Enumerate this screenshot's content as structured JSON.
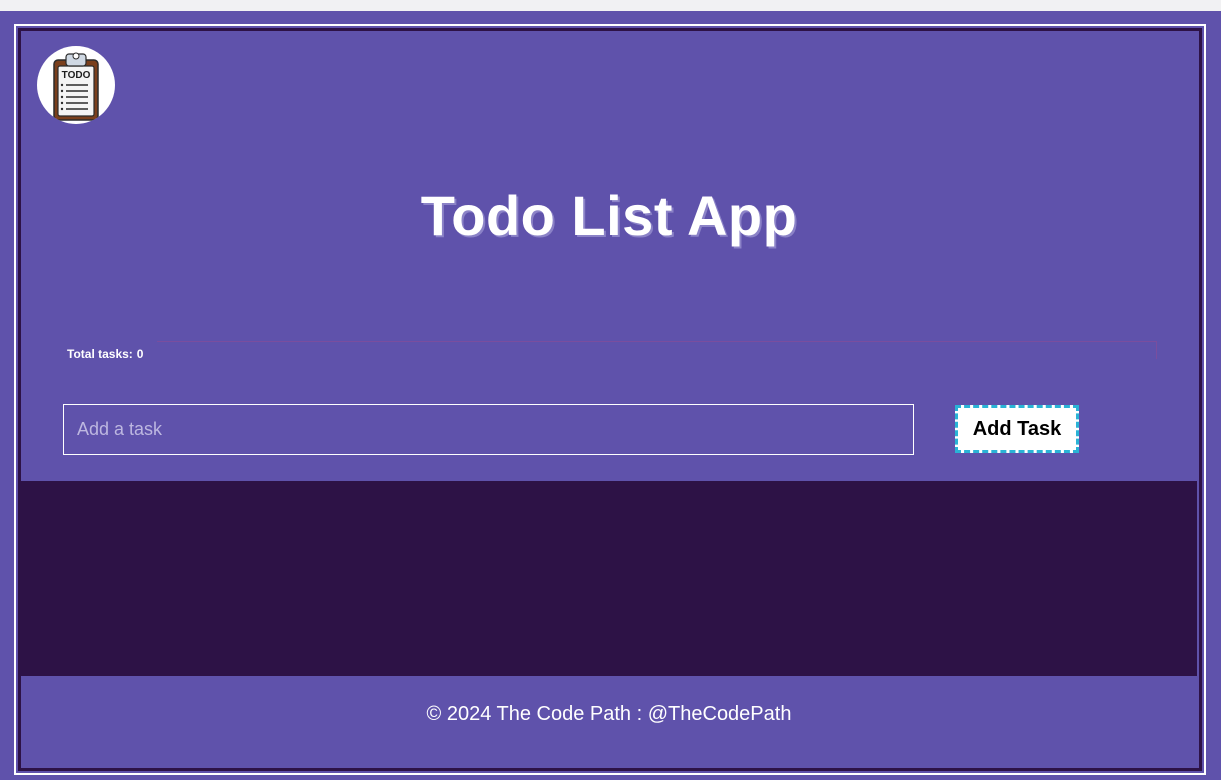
{
  "header": {
    "logo_text": "TODO",
    "title": "Todo List App"
  },
  "stats": {
    "total_label": "Total tasks:",
    "total_value": "0"
  },
  "form": {
    "placeholder": "Add a task",
    "value": "",
    "add_label": "Add Task"
  },
  "tasks": [],
  "footer": {
    "text": "© 2024 The Code Path : @TheCodePath"
  },
  "colors": {
    "primary": "#5f52ab",
    "dark": "#2d1246",
    "accent_dashed": "#2ab3d6",
    "text": "#ffffff"
  },
  "icons": {
    "logo": "clipboard-todo-icon"
  }
}
